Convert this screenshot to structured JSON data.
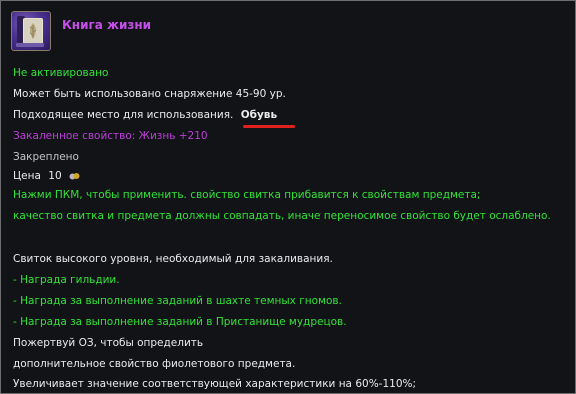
{
  "item": {
    "title": "Книга жизни",
    "icon": "scroll-book-icon",
    "status": "Не активировано",
    "equip_range": "Может быть использовано снаряжение 45-90 ур.",
    "slot_label": "Подходящее место для использования.",
    "slot_value": "Обувь",
    "tempered_property": "Закаленное свойство: Жизнь +210",
    "bound": "Закреплено",
    "price_label": "Цена",
    "price_value": "10",
    "instructions": [
      "Нажми ПКМ, чтобы применить. свойство свитка прибавится к свойствам предмета;",
      "качество свитка и предмета должны совпадать, иначе переносимое свойство будет ослаблено."
    ],
    "description": [
      "Свиток высокого уровня, необходимый для закаливания.",
      "- Награда гильдии.",
      "- Награда за выполнение заданий в шахте темных гномов.",
      "- Награда за выполнение заданий в Пристанище мудрецов.",
      "Пожертвуй ОЗ, чтобы определить",
      "дополнительное свойство фиолетового предмета.",
      "Увеличивает значение соответствующей характеристики на 60%-110%;"
    ]
  },
  "colors": {
    "background": "#111317",
    "title": "#c64fea",
    "green": "#32e337",
    "purple": "#bd3ed8",
    "text": "#ececec",
    "underline": "#e0201e"
  }
}
